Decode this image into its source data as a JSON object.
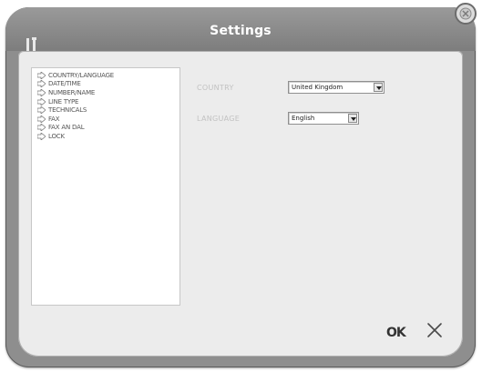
{
  "window": {
    "title": "Settings"
  },
  "tree": {
    "items": [
      {
        "label": "COUNTRY/LANGUAGE"
      },
      {
        "label": "DATE/TIME"
      },
      {
        "label": "NUMBER/NAME"
      },
      {
        "label": "LINE TYPE"
      },
      {
        "label": "TECHNICALS"
      },
      {
        "label": "FAX"
      },
      {
        "label": "FAX AN DAL"
      },
      {
        "label": "LOCK"
      }
    ]
  },
  "form": {
    "country_label": "COUNTRY",
    "country_value": "United Kingdom",
    "language_label": "LANGUAGE",
    "language_value": "English"
  },
  "actions": {
    "ok_label": "OK"
  },
  "icons": {
    "tools": "tools-icon",
    "close_top": "close-circle-icon",
    "cancel": "x-icon",
    "tree_item": "arrow-right-icon"
  }
}
